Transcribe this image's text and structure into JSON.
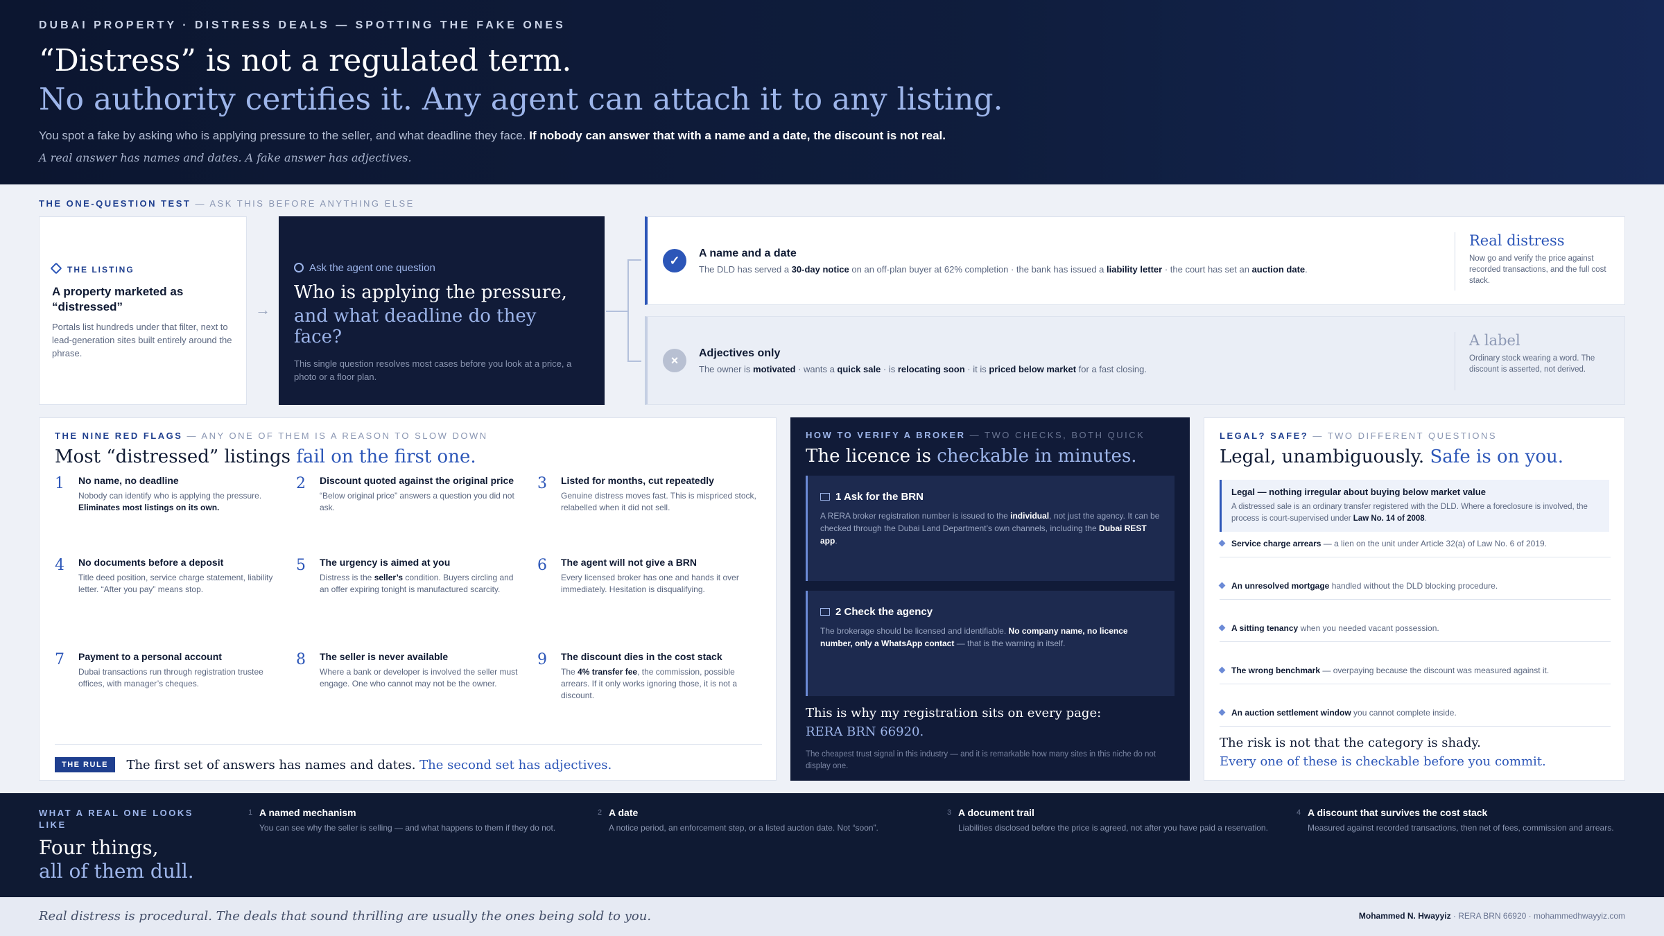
{
  "header": {
    "kicker": "DUBAI PROPERTY · DISTRESS DEALS — SPOTTING THE FAKE ONES",
    "headline": "“Distress” is not a regulated term.",
    "headline_2": "No authority certifies it. Any agent can attach it to any listing.",
    "lead": "You spot a fake by asking who is applying pressure to the seller, and what deadline they face.",
    "lead_bold": "If nobody can answer that with a name and a date, the discount is not real.",
    "sub": "A real answer has names and dates. A fake answer has adjectives."
  },
  "test": {
    "label": "THE ONE-QUESTION TEST",
    "label_sub": "— ASK THIS BEFORE ANYTHING ELSE",
    "listing": {
      "tag": "THE LISTING",
      "title": "A property marketed as “distressed”",
      "desc": "Portals list hundreds under that filter, next to lead-generation sites built entirely around the phrase."
    },
    "arrow": "→",
    "ask": {
      "kicker": "Ask the agent one question",
      "q1": "Who is applying the pressure,",
      "q2": "and what deadline do they face?",
      "desc": "This single question resolves most cases before you look at a price, a photo or a floor plan."
    },
    "real": {
      "icon": "✓",
      "title": "A name and a date",
      "d1": "The DLD has served a ",
      "b1": "30-day notice",
      "d2": " on an off-plan buyer at 62% completion · the bank has issued a ",
      "b2": "liability letter",
      "d3": " · the court has set an ",
      "b3": "auction date",
      "d4": ".",
      "side_title": "Real distress",
      "side_text": "Now go and verify the price against recorded transactions, and the full cost stack."
    },
    "fake": {
      "icon": "×",
      "title": "Adjectives only",
      "d1": "The owner is ",
      "b1": "motivated",
      "d2": " · wants a ",
      "b2": "quick sale",
      "d3": " · is ",
      "b3": "relocating soon",
      "d4": " · it is ",
      "b4": "priced below market",
      "d5": " for a fast closing.",
      "side_title": "A label",
      "side_text": "Ordinary stock wearing a word. The discount is asserted, not derived."
    }
  },
  "flags": {
    "label": "THE NINE RED FLAGS",
    "label_sub": "— ANY ONE OF THEM IS A REASON TO SLOW DOWN",
    "title": "Most “distressed” listings ",
    "title_accent": "fail on the first one.",
    "items": [
      {
        "n": "1",
        "h": "No name, no deadline",
        "p": "Nobody can identify who is applying the pressure. ",
        "pb": "Eliminates most listings on its own.",
        "p2": ""
      },
      {
        "n": "2",
        "h": "Discount quoted against the original price",
        "p": "“Below original price” answers a question you did not ask.",
        "pb": "",
        "p2": ""
      },
      {
        "n": "3",
        "h": "Listed for months, cut repeatedly",
        "p": "Genuine distress moves fast. This is mispriced stock, relabelled when it did not sell.",
        "pb": "",
        "p2": ""
      },
      {
        "n": "4",
        "h": "No documents before a deposit",
        "p": "Title deed position, service charge statement, liability letter. “After you pay” means stop.",
        "pb": "",
        "p2": ""
      },
      {
        "n": "5",
        "h": "The urgency is aimed at you",
        "p": "Distress is the ",
        "pb": "seller’s",
        "p2": " condition. Buyers circling and an offer expiring tonight is manufactured scarcity."
      },
      {
        "n": "6",
        "h": "The agent will not give a BRN",
        "p": "Every licensed broker has one and hands it over immediately. Hesitation is disqualifying.",
        "pb": "",
        "p2": ""
      },
      {
        "n": "7",
        "h": "Payment to a personal account",
        "p": "Dubai transactions run through registration trustee offices, with manager’s cheques.",
        "pb": "",
        "p2": ""
      },
      {
        "n": "8",
        "h": "The seller is never available",
        "p": "Where a bank or developer is involved the seller must engage. One who cannot may not be the owner.",
        "pb": "",
        "p2": ""
      },
      {
        "n": "9",
        "h": "The discount dies in the cost stack",
        "p": "The ",
        "pb": "4% transfer fee",
        "p2": ", the commission, possible arrears. If it only works ignoring those, it is not a discount."
      }
    ],
    "rule_chip": "THE RULE",
    "rule_text": "The first set of answers has names and dates. ",
    "rule_accent": "The second set has adjectives."
  },
  "verify": {
    "label": "HOW TO VERIFY A BROKER",
    "label_sub": "— TWO CHECKS, BOTH QUICK",
    "title": "The licence is ",
    "title_accent": "checkable in minutes.",
    "step1_title": "1  Ask for the BRN",
    "step1_p1": "A RERA broker registration number is issued to the ",
    "step1_b1": "individual",
    "step1_p2": ", not just the agency. It can be checked through the Dubai Land Department’s own channels, including the ",
    "step1_b2": "Dubai REST app",
    "step1_p3": ".",
    "step2_title": "2  Check the agency",
    "step2_p1": "The brokerage should be licensed and identifiable. ",
    "step2_b1": "No company name, no licence number, only a WhatsApp contact",
    "step2_p2": " — that is the warning in itself.",
    "foot_a": "This is why my registration sits on every page:",
    "foot_b": "RERA BRN 66920.",
    "foot_c": "The cheapest trust signal in this industry — and it is remarkable how many sites in this niche do not display one."
  },
  "legal": {
    "label": "LEGAL? SAFE?",
    "label_sub": "— TWO DIFFERENT QUESTIONS",
    "title": "Legal, unambiguously. ",
    "title_accent": "Safe is on you.",
    "box_title": "Legal — nothing irregular about buying below market value",
    "box_p": "A distressed sale is an ordinary transfer registered with the DLD. Where a foreclosure is involved, the process is court-supervised under ",
    "box_b": "Law No. 14 of 2008",
    "box_p2": ".",
    "items": [
      {
        "b": "Service charge arrears",
        "t": " — a lien on the unit under Article 32(a) of Law No. 6 of 2019."
      },
      {
        "b": "An unresolved mortgage",
        "t": " handled without the DLD blocking procedure."
      },
      {
        "b": "A sitting tenancy",
        "t": " when you needed vacant possession."
      },
      {
        "b": "The wrong benchmark",
        "t": " — overpaying because the discount was measured against it."
      },
      {
        "b": "An auction settlement window",
        "t": " you cannot complete inside."
      }
    ],
    "foot_a": "The risk is not that the category is shady.",
    "foot_b": "Every one of these is checkable before you commit."
  },
  "band": {
    "label": "WHAT A REAL ONE LOOKS LIKE",
    "big1": "Four things,",
    "big2": "all of them dull.",
    "items": [
      {
        "n": "1",
        "h": "A named mechanism",
        "p": "You can see why the seller is selling — and what happens to them if they do not."
      },
      {
        "n": "2",
        "h": "A date",
        "p": "A notice period, an enforcement step, or a listed auction date. Not “soon”."
      },
      {
        "n": "3",
        "h": "A document trail",
        "p": "Liabilities disclosed before the price is agreed, not after you have paid a reservation."
      },
      {
        "n": "4",
        "h": "A discount that survives the cost stack",
        "p": "Measured against recorded transactions, then net of fees, commission and arrears."
      }
    ]
  },
  "footer": {
    "quote": "Real distress is procedural. The deals that sound thrilling are usually the ones being sold to you.",
    "name": "Mohammed N. Hwayyiz",
    "meta": " · RERA BRN 66920 · mohammedhwayyiz.com"
  }
}
